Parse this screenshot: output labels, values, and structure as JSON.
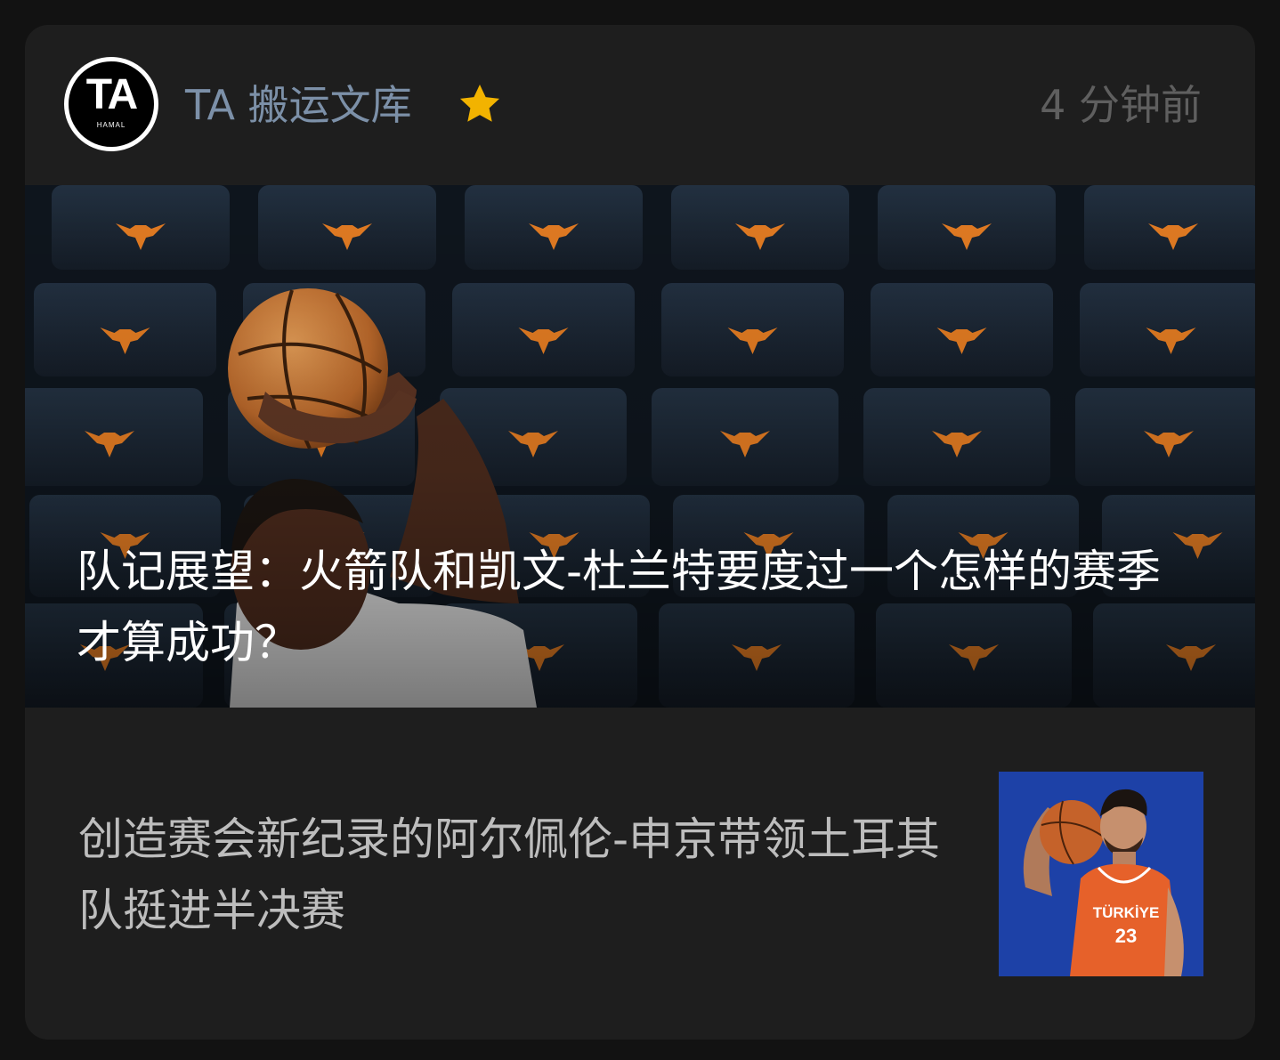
{
  "account": {
    "avatar_text": "TA",
    "avatar_subtext": "HAMAL",
    "name": "TA 搬运文库",
    "badge_icon": "star-icon",
    "time_ago": "4 分钟前"
  },
  "featured": {
    "title": "队记展望：火箭队和凯文-杜兰特要度过一个怎样的赛季才算成功？",
    "image": "basketball-player-shooting-in-empty-arena"
  },
  "article": {
    "title": "创造赛会新纪录的阿尔佩伦-申京带领土耳其队挺进半决赛",
    "thumbnail": "player-in-turkiye-jersey-holding-ball",
    "jersey_text": "TÜRKİYE",
    "jersey_number": "23"
  },
  "colors": {
    "background": "#121212",
    "card": "#1e1e1e",
    "account_name": "#7c90a8",
    "time": "#5f5f5f",
    "star": "#f2b300",
    "seat_logo": "#e07a22"
  }
}
